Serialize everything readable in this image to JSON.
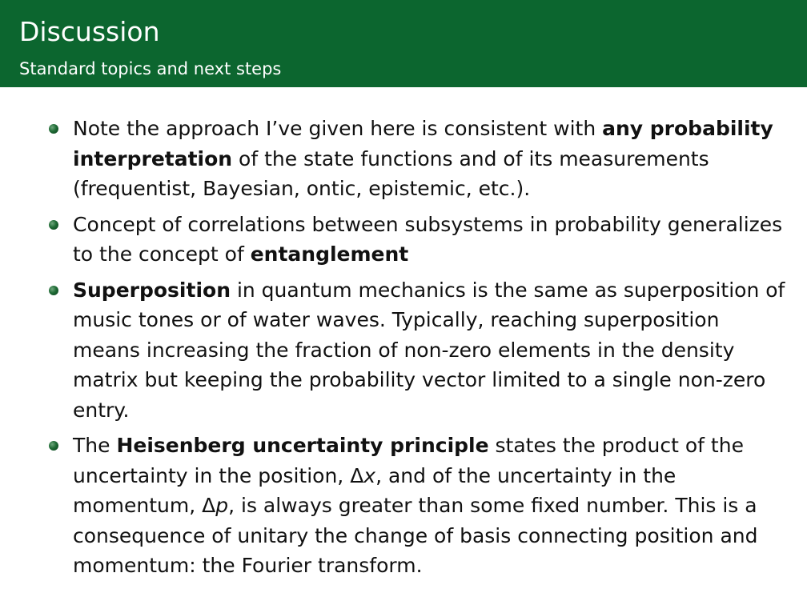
{
  "slide": {
    "title": "Discussion",
    "subtitle": "Standard topics and next steps",
    "header_color": "#0c662f"
  },
  "bullets": [
    {
      "lines": [
        [
          {
            "text": "Note the approach I’ve given here is consistent with "
          },
          {
            "text": "any probability",
            "bold": true
          }
        ],
        [
          {
            "text": "interpretation",
            "bold": true
          },
          {
            "text": " of the state functions and of its measurements"
          }
        ],
        [
          {
            "text": "(frequentist, Bayesian, ontic, epistemic, etc.)."
          }
        ]
      ]
    },
    {
      "lines": [
        [
          {
            "text": "Concept of correlations between subsystems in probability generalizes"
          }
        ],
        [
          {
            "text": "to the concept of "
          },
          {
            "text": "entanglement",
            "bold": true
          }
        ]
      ]
    },
    {
      "lines": [
        [
          {
            "text": "Superposition",
            "bold": true
          },
          {
            "text": " in quantum mechanics is the same as superposition of"
          }
        ],
        [
          {
            "text": "music tones or of water waves.  Typically, reaching superposition"
          }
        ],
        [
          {
            "text": "means increasing the fraction of non-zero elements in the density"
          }
        ],
        [
          {
            "text": "matrix but keeping the probability vector limited to a single non-zero"
          }
        ],
        [
          {
            "text": "entry."
          }
        ]
      ]
    },
    {
      "lines": [
        [
          {
            "text": "The "
          },
          {
            "text": "Heisenberg uncertainty principle",
            "bold": true
          },
          {
            "text": " states the product of the"
          }
        ],
        [
          {
            "text": "uncertainty in the position, "
          },
          {
            "text": "Δ"
          },
          {
            "text": "x",
            "math": true
          },
          {
            "text": ", and of the uncertainty in the"
          }
        ],
        [
          {
            "text": "momentum, "
          },
          {
            "text": "Δ"
          },
          {
            "text": "p",
            "math": true
          },
          {
            "text": ", is always greater than some fixed number.  This is a"
          }
        ],
        [
          {
            "text": "consequence of unitary the change of basis connecting position and"
          }
        ],
        [
          {
            "text": "momentum:  the Fourier transform."
          }
        ]
      ]
    }
  ]
}
